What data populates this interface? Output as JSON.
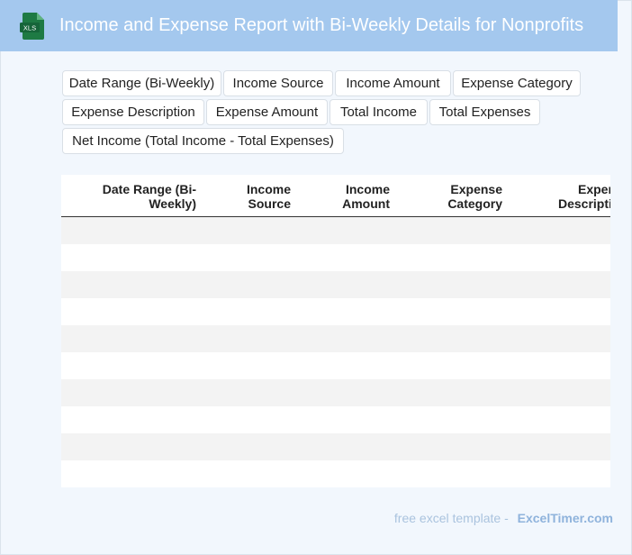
{
  "header": {
    "title": "Income and Expense Report with Bi-Weekly Details for Nonprofits",
    "icon_label": "XLS",
    "icon_color": "#1e7a44",
    "bar_color": "#a4c8ee"
  },
  "tags": [
    "Date Range (Bi-Weekly)",
    "Income Source",
    "Income Amount",
    "Expense Category",
    "Expense Description",
    "Expense Amount",
    "Total Income",
    "Total Expenses",
    "Net Income (Total Income - Total Expenses)"
  ],
  "table": {
    "columns": [
      {
        "line1": "Date Range (Bi-",
        "line2": "Weekly)"
      },
      {
        "line1": "Income",
        "line2": "Source"
      },
      {
        "line1": "Income",
        "line2": "Amount"
      },
      {
        "line1": "Expense",
        "line2": "Category"
      },
      {
        "line1": "Expense",
        "line2": "Description"
      }
    ],
    "row_count": 10
  },
  "footer": {
    "text": "free excel template -",
    "brand": "ExcelTimer.com"
  }
}
